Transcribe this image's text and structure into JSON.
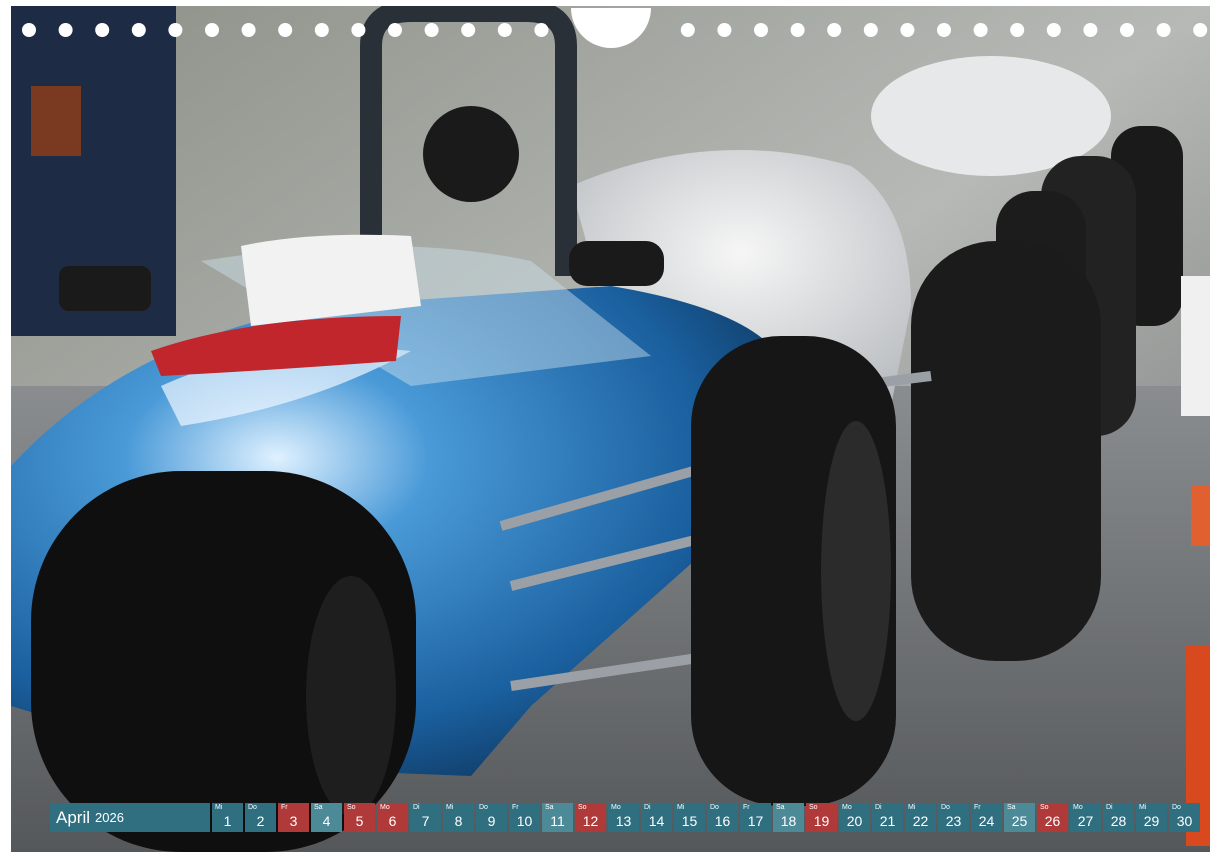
{
  "calendar": {
    "month": "April",
    "year": "2026",
    "days": [
      {
        "dn": "Mi",
        "d": "1",
        "t": "wk"
      },
      {
        "dn": "Do",
        "d": "2",
        "t": "wk"
      },
      {
        "dn": "Fr",
        "d": "3",
        "t": "su"
      },
      {
        "dn": "Sa",
        "d": "4",
        "t": "sa"
      },
      {
        "dn": "So",
        "d": "5",
        "t": "su"
      },
      {
        "dn": "Mo",
        "d": "6",
        "t": "su"
      },
      {
        "dn": "Di",
        "d": "7",
        "t": "wk"
      },
      {
        "dn": "Mi",
        "d": "8",
        "t": "wk"
      },
      {
        "dn": "Do",
        "d": "9",
        "t": "wk"
      },
      {
        "dn": "Fr",
        "d": "10",
        "t": "wk"
      },
      {
        "dn": "Sa",
        "d": "11",
        "t": "sa"
      },
      {
        "dn": "So",
        "d": "12",
        "t": "su"
      },
      {
        "dn": "Mo",
        "d": "13",
        "t": "wk"
      },
      {
        "dn": "Di",
        "d": "14",
        "t": "wk"
      },
      {
        "dn": "Mi",
        "d": "15",
        "t": "wk"
      },
      {
        "dn": "Do",
        "d": "16",
        "t": "wk"
      },
      {
        "dn": "Fr",
        "d": "17",
        "t": "wk"
      },
      {
        "dn": "Sa",
        "d": "18",
        "t": "sa"
      },
      {
        "dn": "So",
        "d": "19",
        "t": "su"
      },
      {
        "dn": "Mo",
        "d": "20",
        "t": "wk"
      },
      {
        "dn": "Di",
        "d": "21",
        "t": "wk"
      },
      {
        "dn": "Mi",
        "d": "22",
        "t": "wk"
      },
      {
        "dn": "Do",
        "d": "23",
        "t": "wk"
      },
      {
        "dn": "Fr",
        "d": "24",
        "t": "wk"
      },
      {
        "dn": "Sa",
        "d": "25",
        "t": "sa"
      },
      {
        "dn": "So",
        "d": "26",
        "t": "su"
      },
      {
        "dn": "Mo",
        "d": "27",
        "t": "wk"
      },
      {
        "dn": "Di",
        "d": "28",
        "t": "wk"
      },
      {
        "dn": "Mi",
        "d": "29",
        "t": "wk"
      },
      {
        "dn": "Do",
        "d": "30",
        "t": "wk"
      }
    ]
  },
  "colors": {
    "weekday": "#2f6f80",
    "saturday": "#4d8a98",
    "holiday": "#b03a3a",
    "car_blue": "#1f6fb2"
  }
}
